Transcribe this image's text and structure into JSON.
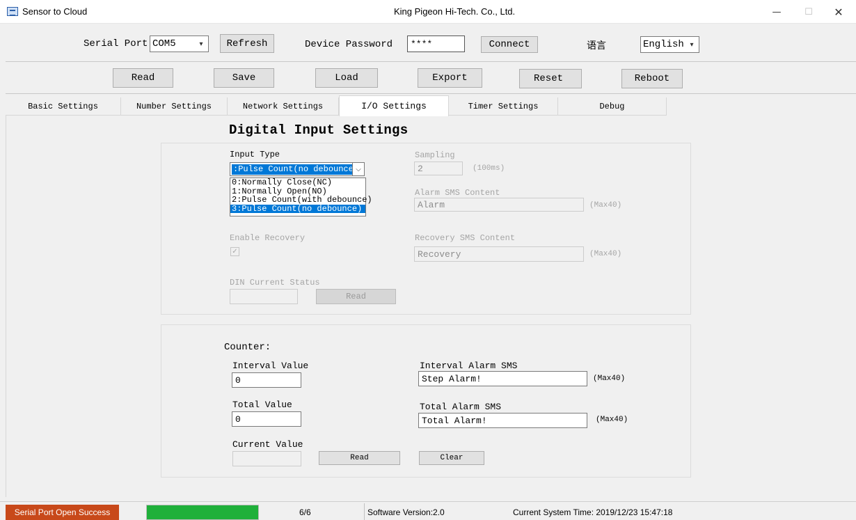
{
  "window": {
    "title": "Sensor to Cloud",
    "company": "King Pigeon Hi-Tech. Co., Ltd.",
    "minimize_glyph": "—",
    "maximize_glyph": "☐",
    "close_glyph": "✕"
  },
  "connection": {
    "serial_port_label": "Serial Port",
    "serial_port_value": "COM5",
    "refresh_label": "Refresh",
    "password_label": "Device Password",
    "password_value": "****",
    "connect_label": "Connect",
    "language_label": "语言",
    "language_value": "English"
  },
  "toolbar": {
    "read": "Read",
    "save": "Save",
    "load": "Load",
    "export": "Export",
    "reset": "Reset",
    "reboot": "Reboot"
  },
  "tabs": [
    "Basic Settings",
    "Number Settings",
    "Network Settings",
    "I/O Settings",
    "Timer Settings",
    "Debug"
  ],
  "active_tab": "I/O Settings",
  "digital_input": {
    "heading": "Digital Input Settings",
    "input_type_label": "Input Type",
    "input_type_value": ":Pulse Count(no debounce)",
    "input_type_options": [
      "0:Normally Close(NC)",
      "1:Normally Open(NO)",
      "2:Pulse Count(with debounce)",
      "3:Pulse Count(no debounce)"
    ],
    "selected_option_index": 3,
    "sampling_label": "Sampling",
    "sampling_value": "2",
    "sampling_unit": "(100ms)",
    "alarm_sms_label": "Alarm SMS Content",
    "alarm_sms_value": "Alarm",
    "alarm_sms_max": "(Max40)",
    "enable_recovery_label": "Enable Recovery",
    "enable_recovery_checked": true,
    "recovery_sms_label": "Recovery SMS Content",
    "recovery_sms_value": "Recovery",
    "recovery_sms_max": "(Max40)",
    "din_status_label": "DIN Current Status",
    "din_status_value": "",
    "read_label": "Read"
  },
  "counter": {
    "heading": "Counter:",
    "interval_value_label": "Interval Value",
    "interval_value": "0",
    "interval_alarm_label": "Interval Alarm SMS",
    "interval_alarm_value": "Step Alarm!",
    "interval_alarm_max": "(Max40)",
    "total_value_label": "Total Value",
    "total_value": "0",
    "total_alarm_label": "Total Alarm SMS",
    "total_alarm_value": "Total Alarm!",
    "total_alarm_max": "(Max40)",
    "current_value_label": "Current Value",
    "current_value": "",
    "read_label": "Read",
    "clear_label": "Clear"
  },
  "status": {
    "message": "Serial Port Open Success",
    "progress_fraction": 1.0,
    "progress_text": "6/6",
    "software_version": "Software Version:2.0",
    "system_time": "Current System Time: 2019/12/23 15:47:18",
    "colors": {
      "message_bg": "#c8491a",
      "progress": "#1fb03a",
      "select_highlight": "#0078d7"
    }
  }
}
